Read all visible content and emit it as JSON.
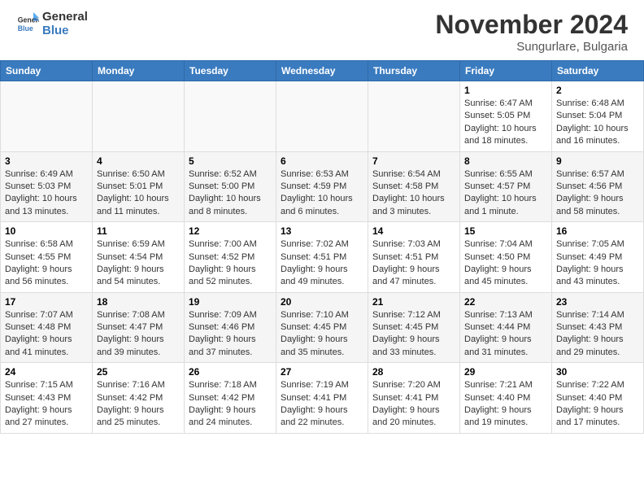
{
  "header": {
    "logo_general": "General",
    "logo_blue": "Blue",
    "month": "November 2024",
    "location": "Sungurlare, Bulgaria"
  },
  "weekdays": [
    "Sunday",
    "Monday",
    "Tuesday",
    "Wednesday",
    "Thursday",
    "Friday",
    "Saturday"
  ],
  "rows": [
    [
      {
        "day": "",
        "info": ""
      },
      {
        "day": "",
        "info": ""
      },
      {
        "day": "",
        "info": ""
      },
      {
        "day": "",
        "info": ""
      },
      {
        "day": "",
        "info": ""
      },
      {
        "day": "1",
        "info": "Sunrise: 6:47 AM\nSunset: 5:05 PM\nDaylight: 10 hours and 18 minutes."
      },
      {
        "day": "2",
        "info": "Sunrise: 6:48 AM\nSunset: 5:04 PM\nDaylight: 10 hours and 16 minutes."
      }
    ],
    [
      {
        "day": "3",
        "info": "Sunrise: 6:49 AM\nSunset: 5:03 PM\nDaylight: 10 hours and 13 minutes."
      },
      {
        "day": "4",
        "info": "Sunrise: 6:50 AM\nSunset: 5:01 PM\nDaylight: 10 hours and 11 minutes."
      },
      {
        "day": "5",
        "info": "Sunrise: 6:52 AM\nSunset: 5:00 PM\nDaylight: 10 hours and 8 minutes."
      },
      {
        "day": "6",
        "info": "Sunrise: 6:53 AM\nSunset: 4:59 PM\nDaylight: 10 hours and 6 minutes."
      },
      {
        "day": "7",
        "info": "Sunrise: 6:54 AM\nSunset: 4:58 PM\nDaylight: 10 hours and 3 minutes."
      },
      {
        "day": "8",
        "info": "Sunrise: 6:55 AM\nSunset: 4:57 PM\nDaylight: 10 hours and 1 minute."
      },
      {
        "day": "9",
        "info": "Sunrise: 6:57 AM\nSunset: 4:56 PM\nDaylight: 9 hours and 58 minutes."
      }
    ],
    [
      {
        "day": "10",
        "info": "Sunrise: 6:58 AM\nSunset: 4:55 PM\nDaylight: 9 hours and 56 minutes."
      },
      {
        "day": "11",
        "info": "Sunrise: 6:59 AM\nSunset: 4:54 PM\nDaylight: 9 hours and 54 minutes."
      },
      {
        "day": "12",
        "info": "Sunrise: 7:00 AM\nSunset: 4:52 PM\nDaylight: 9 hours and 52 minutes."
      },
      {
        "day": "13",
        "info": "Sunrise: 7:02 AM\nSunset: 4:51 PM\nDaylight: 9 hours and 49 minutes."
      },
      {
        "day": "14",
        "info": "Sunrise: 7:03 AM\nSunset: 4:51 PM\nDaylight: 9 hours and 47 minutes."
      },
      {
        "day": "15",
        "info": "Sunrise: 7:04 AM\nSunset: 4:50 PM\nDaylight: 9 hours and 45 minutes."
      },
      {
        "day": "16",
        "info": "Sunrise: 7:05 AM\nSunset: 4:49 PM\nDaylight: 9 hours and 43 minutes."
      }
    ],
    [
      {
        "day": "17",
        "info": "Sunrise: 7:07 AM\nSunset: 4:48 PM\nDaylight: 9 hours and 41 minutes."
      },
      {
        "day": "18",
        "info": "Sunrise: 7:08 AM\nSunset: 4:47 PM\nDaylight: 9 hours and 39 minutes."
      },
      {
        "day": "19",
        "info": "Sunrise: 7:09 AM\nSunset: 4:46 PM\nDaylight: 9 hours and 37 minutes."
      },
      {
        "day": "20",
        "info": "Sunrise: 7:10 AM\nSunset: 4:45 PM\nDaylight: 9 hours and 35 minutes."
      },
      {
        "day": "21",
        "info": "Sunrise: 7:12 AM\nSunset: 4:45 PM\nDaylight: 9 hours and 33 minutes."
      },
      {
        "day": "22",
        "info": "Sunrise: 7:13 AM\nSunset: 4:44 PM\nDaylight: 9 hours and 31 minutes."
      },
      {
        "day": "23",
        "info": "Sunrise: 7:14 AM\nSunset: 4:43 PM\nDaylight: 9 hours and 29 minutes."
      }
    ],
    [
      {
        "day": "24",
        "info": "Sunrise: 7:15 AM\nSunset: 4:43 PM\nDaylight: 9 hours and 27 minutes."
      },
      {
        "day": "25",
        "info": "Sunrise: 7:16 AM\nSunset: 4:42 PM\nDaylight: 9 hours and 25 minutes."
      },
      {
        "day": "26",
        "info": "Sunrise: 7:18 AM\nSunset: 4:42 PM\nDaylight: 9 hours and 24 minutes."
      },
      {
        "day": "27",
        "info": "Sunrise: 7:19 AM\nSunset: 4:41 PM\nDaylight: 9 hours and 22 minutes."
      },
      {
        "day": "28",
        "info": "Sunrise: 7:20 AM\nSunset: 4:41 PM\nDaylight: 9 hours and 20 minutes."
      },
      {
        "day": "29",
        "info": "Sunrise: 7:21 AM\nSunset: 4:40 PM\nDaylight: 9 hours and 19 minutes."
      },
      {
        "day": "30",
        "info": "Sunrise: 7:22 AM\nSunset: 4:40 PM\nDaylight: 9 hours and 17 minutes."
      }
    ]
  ]
}
